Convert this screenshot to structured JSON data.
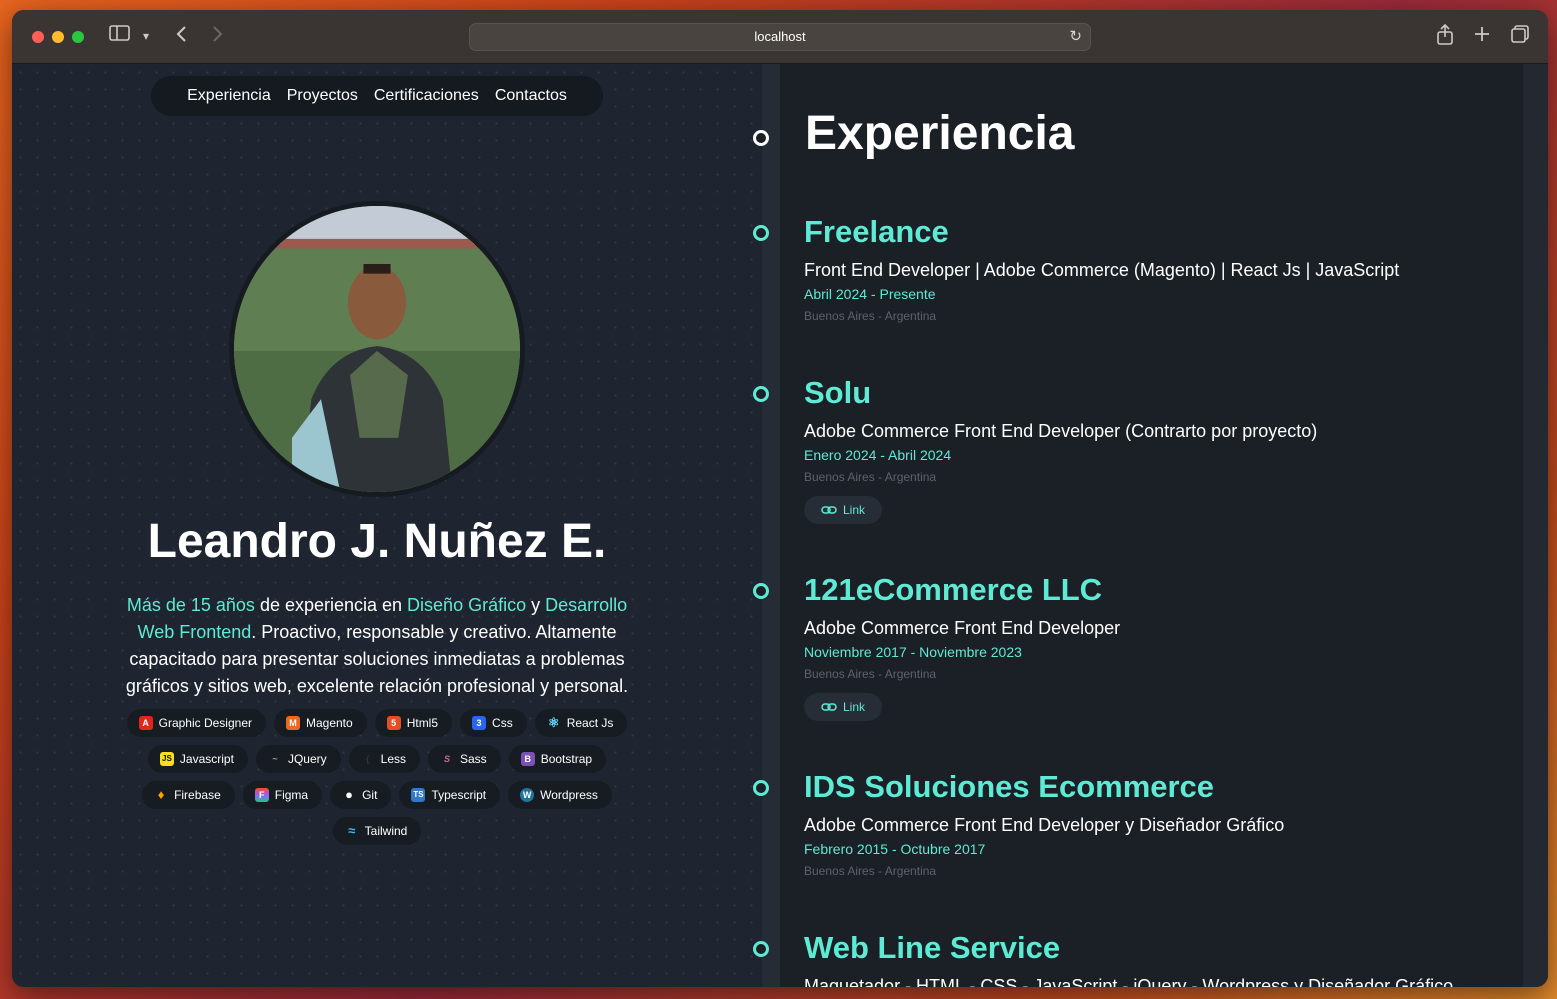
{
  "browser": {
    "url": "localhost"
  },
  "nav": {
    "items": [
      "Experiencia",
      "Proyectos",
      "Certificaciones",
      "Contactos"
    ]
  },
  "profile": {
    "name": "Leandro J. Nuñez E.",
    "bio": {
      "p1": "Más de 15 años",
      "p2": " de experiencia en ",
      "p3": "Diseño Gráfico",
      "p4": " y ",
      "p5": "Desarrollo Web Frontend",
      "p6": ". Proactivo, responsable y creativo. Altamente capacitado para presentar soluciones inmediatas a problemas gráficos y sitios web, excelente relación profesional y personal."
    }
  },
  "skills": [
    {
      "label": "Graphic Designer",
      "icon": "adobe-icon",
      "color": "#e3261b",
      "glyph": "A"
    },
    {
      "label": "Magento",
      "icon": "magento-icon",
      "color": "#ee6723",
      "glyph": "M"
    },
    {
      "label": "Html5",
      "icon": "html5-icon",
      "color": "#e44d26",
      "glyph": "5"
    },
    {
      "label": "Css",
      "icon": "css-icon",
      "color": "#2965f1",
      "glyph": "3"
    },
    {
      "label": "React Js",
      "icon": "react-icon",
      "color": "#1f2530",
      "glyph": "⚛"
    },
    {
      "label": "Javascript",
      "icon": "javascript-icon",
      "color": "#f7df1e",
      "glyph": "JS"
    },
    {
      "label": "JQuery",
      "icon": "jquery-icon",
      "color": "#1f2530",
      "glyph": "~"
    },
    {
      "label": "Less",
      "icon": "less-icon",
      "color": "#1f2530",
      "glyph": "{"
    },
    {
      "label": "Sass",
      "icon": "sass-icon",
      "color": "#cd6799",
      "glyph": "S"
    },
    {
      "label": "Bootstrap",
      "icon": "bootstrap-icon",
      "color": "#7952b3",
      "glyph": "B"
    },
    {
      "label": "Firebase",
      "icon": "firebase-icon",
      "color": "#ffa000",
      "glyph": "♦"
    },
    {
      "label": "Figma",
      "icon": "figma-icon",
      "color": "#a259ff",
      "glyph": "F"
    },
    {
      "label": "Git",
      "icon": "github-icon",
      "color": "#1f2530",
      "glyph": "●"
    },
    {
      "label": "Typescript",
      "icon": "typescript-icon",
      "color": "#3178c6",
      "glyph": "TS"
    },
    {
      "label": "Wordpress",
      "icon": "wordpress-icon",
      "color": "#21759b",
      "glyph": "W"
    },
    {
      "label": "Tailwind",
      "icon": "tailwind-icon",
      "color": "#1f2530",
      "glyph": "≈"
    }
  ],
  "experience": {
    "title": "Experiencia",
    "link_label": "Link",
    "jobs": [
      {
        "company": "Freelance",
        "role": "Front End Developer | Adobe Commerce (Magento) | React Js | JavaScript",
        "date": "Abril 2024 - Presente",
        "location": "Buenos Aires - Argentina"
      },
      {
        "company": "Solu",
        "role": "Adobe Commerce Front End Developer (Contrarto por proyecto)",
        "date": "Enero 2024 - Abril 2024",
        "location": "Buenos Aires - Argentina"
      },
      {
        "company": "121eCommerce LLC",
        "role": "Adobe Commerce Front End Developer",
        "date": "Noviembre 2017 - Noviembre 2023",
        "location": "Buenos Aires - Argentina"
      },
      {
        "company": "IDS Soluciones Ecommerce",
        "role": "Adobe Commerce Front End Developer y Diseñador Gráfico",
        "date": "Febrero 2015 - Octubre 2017",
        "location": "Buenos Aires - Argentina"
      },
      {
        "company": "Web Line Service",
        "role": "Maquetador - HTML - CSS - JavaScript - jQuery - Wordpress y Diseñador Gráfico"
      }
    ]
  },
  "colors": {
    "accent": "#5eead4",
    "background": "#1b1f26"
  }
}
